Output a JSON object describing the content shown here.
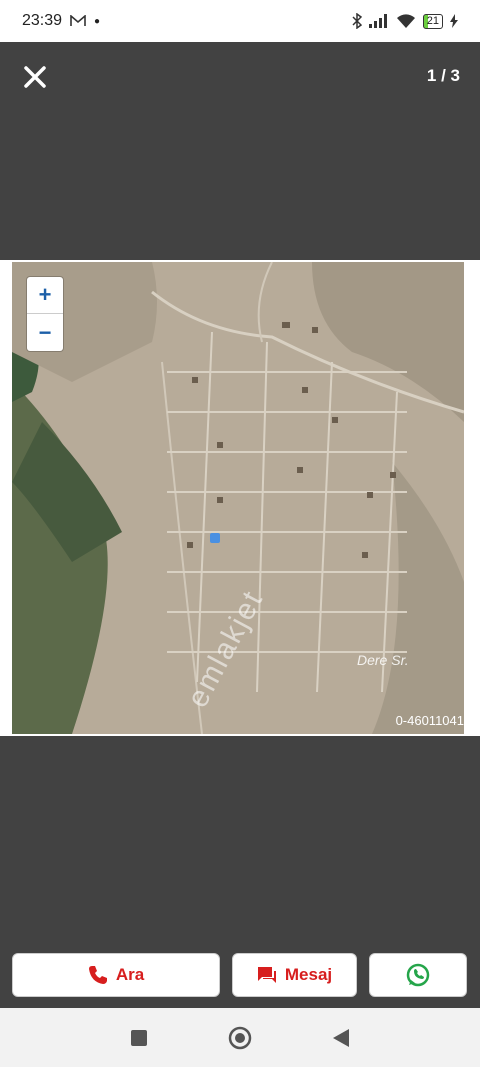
{
  "status_bar": {
    "time": "23:39",
    "battery": "21"
  },
  "viewer": {
    "counter": "1 / 3"
  },
  "map": {
    "zoom_in": "+",
    "zoom_out": "−",
    "watermark": "emlakjet",
    "street_label": "Dere Sr.",
    "listing_id": "0-46011041"
  },
  "actions": {
    "call_label": "Ara",
    "message_label": "Mesaj"
  },
  "colors": {
    "accent": "#d71e1e",
    "whatsapp": "#25a54a",
    "background": "#424242"
  }
}
